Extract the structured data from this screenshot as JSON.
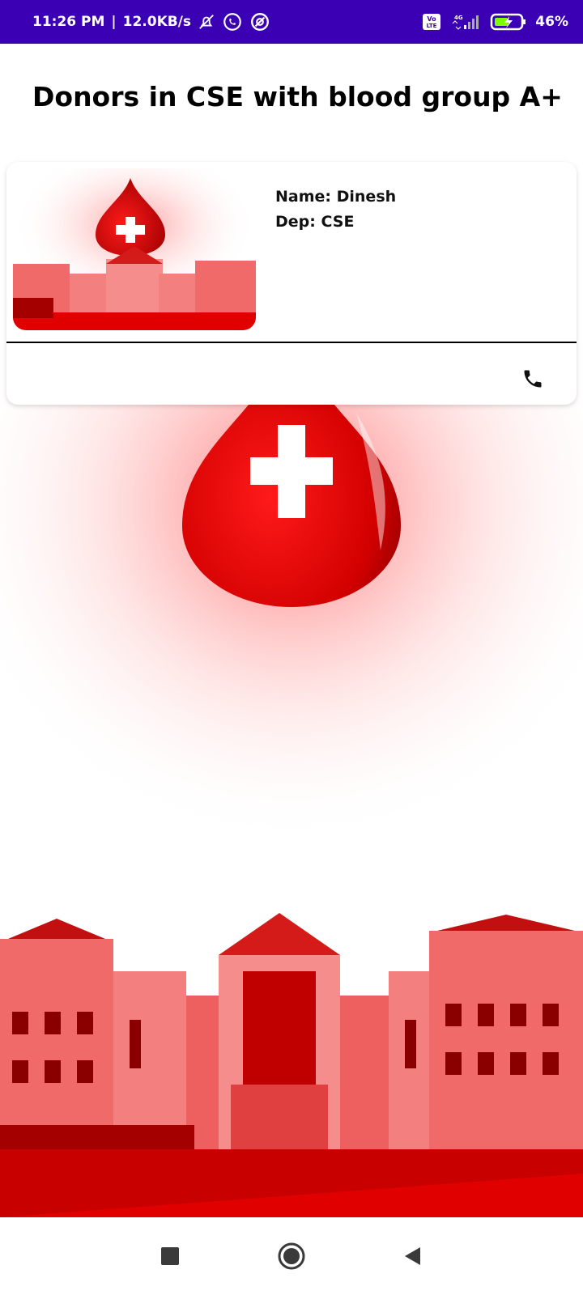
{
  "status_bar": {
    "time": "11:26 PM",
    "separator": "|",
    "speed": "12.0KB/s",
    "battery": "46%",
    "icons": [
      "mute-bell-icon",
      "whatsapp-icon",
      "at-icon",
      "volte-icon",
      "signal-icon",
      "battery-charging-icon"
    ],
    "color": "#3b00b3"
  },
  "page": {
    "title": "Donors in CSE with blood group A+"
  },
  "donor_card": {
    "name_line": "Name: Dinesh",
    "dept_line": "Dep: CSE",
    "call_icon": "phone-icon"
  },
  "nav_bar": {
    "icons": [
      "recents-square-icon",
      "home-circle-icon",
      "back-triangle-icon"
    ]
  },
  "colors": {
    "blood_red": "#e00000",
    "accent_purple": "#3b00b3"
  }
}
